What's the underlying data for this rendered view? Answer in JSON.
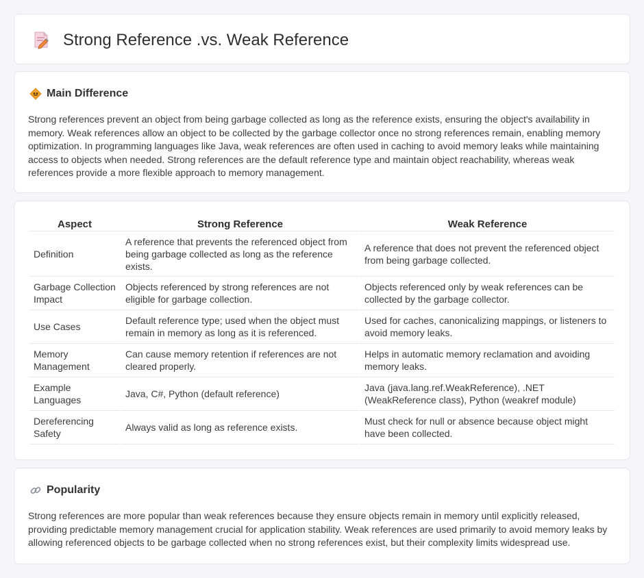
{
  "header": {
    "title": "Strong Reference .vs. Weak Reference",
    "icon": "document-pencil-icon"
  },
  "main_difference": {
    "heading": "Main Difference",
    "icon": "diamond-sign-icon",
    "text": "Strong references prevent an object from being garbage collected as long as the reference exists, ensuring the object's availability in memory. Weak references allow an object to be collected by the garbage collector once no strong references remain, enabling memory optimization. In programming languages like Java, weak references are often used in caching to avoid memory leaks while maintaining access to objects when needed. Strong references are the default reference type and maintain object reachability, whereas weak references provide a more flexible approach to memory management."
  },
  "comparison": {
    "headers": [
      "Aspect",
      "Strong Reference",
      "Weak Reference"
    ],
    "rows": [
      [
        "Definition",
        "A reference that prevents the referenced object from being garbage collected as long as the reference exists.",
        "A reference that does not prevent the referenced object from being garbage collected."
      ],
      [
        "Garbage Collection Impact",
        "Objects referenced by strong references are not eligible for garbage collection.",
        "Objects referenced only by weak references can be collected by the garbage collector."
      ],
      [
        "Use Cases",
        "Default reference type; used when the object must remain in memory as long as it is referenced.",
        "Used for caches, canonicalizing mappings, or listeners to avoid memory leaks."
      ],
      [
        "Memory Management",
        "Can cause memory retention if references are not cleared properly.",
        "Helps in automatic memory reclamation and avoiding memory leaks."
      ],
      [
        "Example Languages",
        "Java, C#, Python (default reference)",
        "Java (java.lang.ref.WeakReference), .NET (WeakReference class), Python (weakref module)"
      ],
      [
        "Dereferencing Safety",
        "Always valid as long as reference exists.",
        "Must check for null or absence because object might have been collected."
      ]
    ]
  },
  "popularity": {
    "heading": "Popularity",
    "icon": "link-icon",
    "text": "Strong references are more popular than weak references because they ensure objects remain in memory until explicitly released, providing predictable memory management crucial for application stability. Weak references are used primarily to avoid memory leaks by allowing referenced objects to be garbage collected when no strong references exist, but their complexity limits widespread use."
  },
  "colors": {
    "background": "#f5f6fa",
    "card": "#ffffff",
    "border": "#e3e5ec",
    "accent_orange": "#f0a030"
  }
}
